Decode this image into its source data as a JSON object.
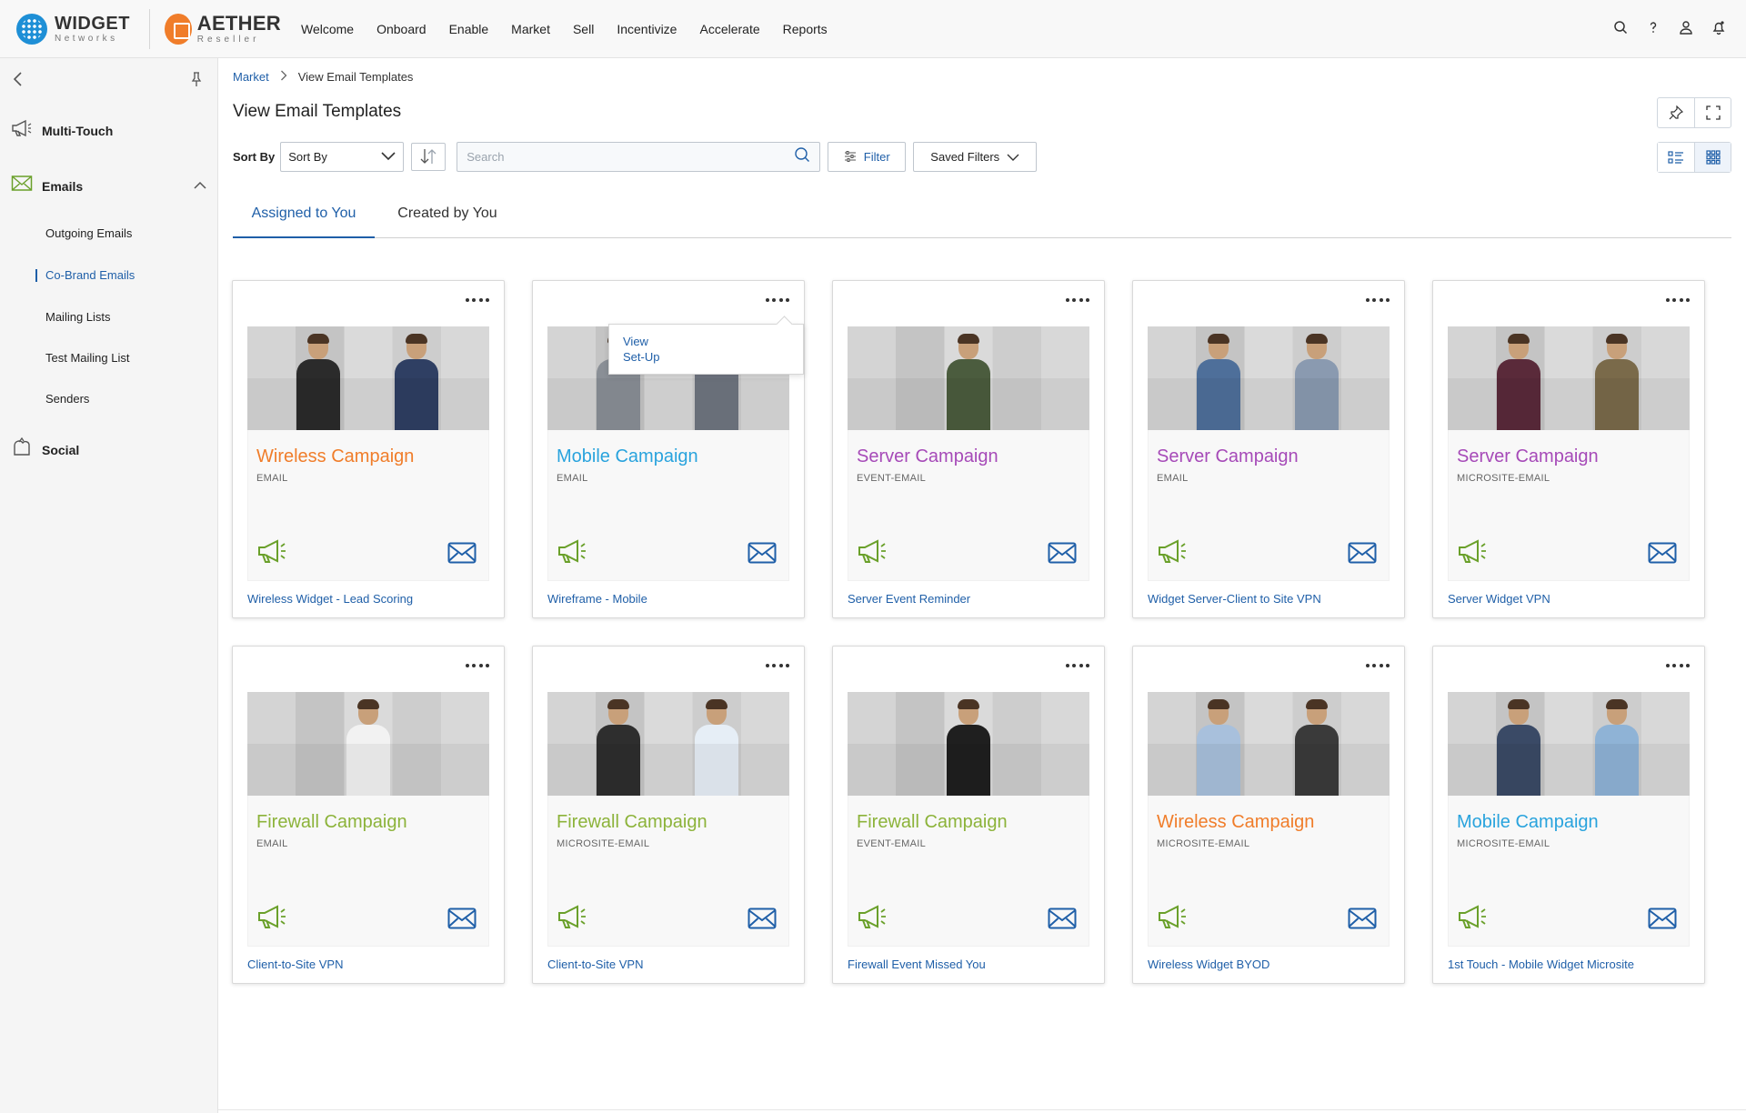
{
  "brand": {
    "widget_name": "WIDGET",
    "widget_sub": "Networks",
    "aether_name": "AETHER",
    "aether_sub": "Reseller"
  },
  "topnav": [
    "Welcome",
    "Onboard",
    "Enable",
    "Market",
    "Sell",
    "Incentivize",
    "Accelerate",
    "Reports"
  ],
  "top_icons": [
    "search-icon",
    "help-icon",
    "user-icon",
    "notification-bell-icon"
  ],
  "sidebar": {
    "groups": [
      {
        "label": "Multi-Touch",
        "icon": "megaphone-icon"
      },
      {
        "label": "Emails",
        "icon": "envelope-icon",
        "expanded": true
      },
      {
        "label": "Social",
        "icon": "social-icon"
      }
    ],
    "email_items": [
      "Outgoing Emails",
      "Co-Brand Emails",
      "Mailing Lists",
      "Test Mailing List",
      "Senders"
    ],
    "active_item": "Co-Brand Emails"
  },
  "breadcrumb": {
    "parent": "Market",
    "current": "View Email Templates"
  },
  "page_title": "View Email Templates",
  "toolbar": {
    "sort_label": "Sort By",
    "sort_value": "Sort By",
    "search_placeholder": "Search",
    "filter_label": "Filter",
    "saved_filters_label": "Saved Filters"
  },
  "tabs": [
    {
      "label": "Assigned to You",
      "active": true
    },
    {
      "label": "Created by You",
      "active": false
    }
  ],
  "colors": {
    "accent": "#1f5fa8",
    "wireless": "#f07d2a",
    "mobile": "#29a3dd",
    "server": "#a64ab8",
    "firewall": "#8cb33a",
    "megaphone": "#6aa02a"
  },
  "cards": [
    {
      "title": "Wireless Campaign",
      "type": "EMAIL",
      "name": "Wireless Widget - Lead Scoring",
      "color": "#f07d2a"
    },
    {
      "title": "Mobile Campaign",
      "type": "EMAIL",
      "name": "Wireframe - Mobile",
      "color": "#29a3dd"
    },
    {
      "title": "Server Campaign",
      "type": "EVENT-EMAIL",
      "name": "Server Event Reminder",
      "color": "#a64ab8"
    },
    {
      "title": "Server Campaign",
      "type": "EMAIL",
      "name": "Widget Server-Client to Site VPN",
      "color": "#a64ab8"
    },
    {
      "title": "Server Campaign",
      "type": "MICROSITE-EMAIL",
      "name": "Server Widget VPN",
      "color": "#a64ab8"
    },
    {
      "title": "Firewall Campaign",
      "type": "EMAIL",
      "name": "Client-to-Site VPN",
      "color": "#8cb33a"
    },
    {
      "title": "Firewall Campaign",
      "type": "MICROSITE-EMAIL",
      "name": "Client-to-Site VPN",
      "color": "#8cb33a"
    },
    {
      "title": "Firewall Campaign",
      "type": "EVENT-EMAIL",
      "name": "Firewall Event Missed You",
      "color": "#8cb33a"
    },
    {
      "title": "Wireless Campaign",
      "type": "MICROSITE-EMAIL",
      "name": "Wireless Widget BYOD",
      "color": "#f07d2a"
    },
    {
      "title": "Mobile Campaign",
      "type": "MICROSITE-EMAIL",
      "name": "1st Touch - Mobile Widget Microsite",
      "color": "#29a3dd"
    }
  ],
  "card_menu": {
    "items": [
      "View",
      "Set-Up"
    ]
  }
}
